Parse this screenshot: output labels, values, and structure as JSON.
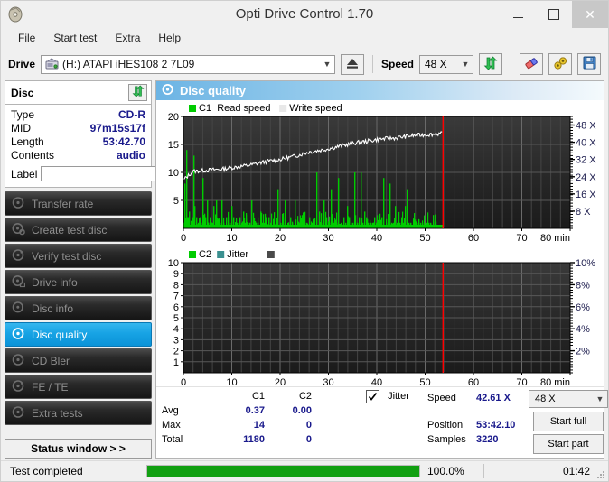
{
  "window": {
    "title": "Opti Drive Control 1.70",
    "icon": "disc-icon",
    "minimize": "–",
    "maximize": "□",
    "close": "×"
  },
  "menu": {
    "items": [
      {
        "label": "File"
      },
      {
        "label": "Start test"
      },
      {
        "label": "Extra"
      },
      {
        "label": "Help"
      }
    ]
  },
  "toolbar": {
    "drive_label": "Drive",
    "drive_value": "(H:)  ATAPI iHES108  2 7L09",
    "eject_icon": "eject-icon",
    "speed_label": "Speed",
    "speed_value": "48 X",
    "refresh_icon": "refresh-icon",
    "eraser_icon": "eraser-icon",
    "tools_icon": "tools-icon",
    "save_icon": "save-icon"
  },
  "disc": {
    "title": "Disc",
    "refresh_icon": "refresh-icon",
    "rows": [
      {
        "key": "Type",
        "value": "CD-R"
      },
      {
        "key": "MID",
        "value": "97m15s17f"
      },
      {
        "key": "Length",
        "value": "53:42.70"
      },
      {
        "key": "Contents",
        "value": "audio"
      }
    ],
    "label_key": "Label",
    "label_value": "",
    "label_placeholder": "",
    "disc_icon": "cd-disc-icon"
  },
  "nav": {
    "items": [
      {
        "label": "Transfer rate",
        "icon": "disc-gear-icon",
        "active": false
      },
      {
        "label": "Create test disc",
        "icon": "disc-write-icon",
        "active": false
      },
      {
        "label": "Verify test disc",
        "icon": "disc-check-icon",
        "active": false
      },
      {
        "label": "Drive info",
        "icon": "drive-info-icon",
        "active": false
      },
      {
        "label": "Disc info",
        "icon": "disc-info-icon",
        "active": false
      },
      {
        "label": "Disc quality",
        "icon": "disc-quality-icon",
        "active": true
      },
      {
        "label": "CD Bler",
        "icon": "disc-bler-icon",
        "active": false
      },
      {
        "label": "FE / TE",
        "icon": "disc-fete-icon",
        "active": false
      },
      {
        "label": "Extra tests",
        "icon": "disc-extra-icon",
        "active": false
      }
    ],
    "status_window_label": "Status window > >"
  },
  "panel": {
    "title": "Disc quality",
    "icon": "disc-quality-icon"
  },
  "stats": {
    "col_headers": [
      "C1",
      "C2"
    ],
    "row_labels": [
      "Avg",
      "Max",
      "Total"
    ],
    "values": [
      [
        "0.37",
        "0.00"
      ],
      [
        "14",
        "0"
      ],
      [
        "1180",
        "0"
      ]
    ],
    "jitter_label": "Jitter",
    "jitter_checked": true,
    "speed_label": "Speed",
    "speed_value": "42.61 X",
    "position_label": "Position",
    "position_value": "53:42.10",
    "samples_label": "Samples",
    "samples_value": "3220",
    "speed_select": "48 X",
    "start_full_label": "Start full",
    "start_part_label": "Start part"
  },
  "statusbar": {
    "message": "Test completed",
    "progress_percent": 100.0,
    "progress_text": "100.0%",
    "elapsed": "01:42"
  },
  "colors": {
    "c1_green": "#00cc00",
    "read_speed_white": "#ffffff",
    "marker_red": "#ff0000",
    "accent_blue": "#1a1a8c",
    "panel_blue": "#6cb4e4",
    "progress_green": "#12a012",
    "plot_bg": "#2b2b2b"
  },
  "chart_data": [
    {
      "id": "c1-chart",
      "type": "bar",
      "title": "",
      "legend": [
        {
          "label": "C1",
          "color": "#00cc00",
          "swatch": true
        },
        {
          "label": "Read speed",
          "color": "#ffffff",
          "swatch": false
        },
        {
          "label": "Write speed",
          "color": "#e8e8e8",
          "swatch": true
        }
      ],
      "legend_position": "top-left",
      "grid": true,
      "xlabel": "min",
      "xlim": [
        0,
        80
      ],
      "xticks": [
        0,
        10,
        20,
        30,
        40,
        50,
        60,
        70,
        80
      ],
      "xticklabels": [
        "0",
        "10",
        "20",
        "30",
        "40",
        "50",
        "60",
        "70",
        "80 min"
      ],
      "ylabel": "C1",
      "ylim": [
        0,
        20
      ],
      "yticks": [
        5,
        10,
        15,
        20
      ],
      "yticklabels": [
        "5",
        "10",
        "15",
        "20"
      ],
      "y2label": "Speed",
      "y2lim": [
        0,
        52
      ],
      "y2ticks": [
        8,
        16,
        24,
        32,
        40,
        48
      ],
      "y2ticklabels": [
        "8 X",
        "16 X",
        "24 X",
        "32 X",
        "40 X",
        "48 X"
      ],
      "marker_x": 53.7,
      "marker_color": "#ff0000",
      "data_end_x": 53.7,
      "series": [
        {
          "name": "C1",
          "type": "bar",
          "color": "#00cc00",
          "x": [
            0.2,
            0.5,
            0.8,
            1.0,
            1.2,
            1.5,
            1.8,
            2.0,
            2.3,
            2.6,
            2.9,
            3.1,
            3.3,
            3.6,
            3.9,
            4.2,
            4.5,
            4.8,
            5.1,
            5.4,
            5.7,
            6.0,
            6.2,
            6.5,
            6.8,
            7.1,
            7.5,
            7.9,
            8.3,
            8.7,
            9.1,
            9.5,
            9.9,
            10.3,
            10.7,
            11.1,
            11.5,
            11.9,
            12.3,
            12.8,
            13.2,
            13.6,
            14.0,
            14.5,
            14.9,
            15.3,
            15.8,
            16.2,
            16.7,
            17.1,
            17.6,
            18.0,
            18.5,
            19.0,
            19.5,
            20.0,
            20.5,
            21.0,
            21.5,
            22.0,
            22.5,
            23.0,
            23.5,
            24.0,
            24.5,
            25.0,
            25.5,
            26.0,
            26.5,
            27.0,
            27.5,
            28.0,
            28.5,
            29.0,
            29.5,
            30.0,
            30.5,
            31.0,
            31.5,
            32.0,
            32.5,
            33.0,
            33.4,
            33.8,
            34.2,
            34.6,
            35.0,
            35.4,
            35.8,
            36.2,
            36.6,
            37.0,
            37.4,
            37.8,
            38.2,
            38.6,
            39.0,
            39.4,
            39.8,
            40.2,
            40.6,
            41.0,
            41.4,
            41.8,
            42.2,
            42.6,
            43.0,
            43.4,
            43.8,
            44.2,
            44.6,
            45.0,
            45.4,
            45.8,
            46.2,
            46.6,
            47.0,
            47.4,
            47.8,
            48.2,
            48.6,
            49.0,
            49.4,
            49.8,
            50.2,
            50.6,
            51.0,
            51.4,
            51.8,
            52.2,
            52.6,
            53.0,
            53.4
          ],
          "values": [
            8,
            14,
            2,
            1,
            3,
            1,
            2,
            13,
            4,
            2,
            1,
            1,
            2,
            1,
            9,
            1,
            2,
            5,
            1,
            2,
            1,
            1,
            4,
            1,
            5,
            1,
            1,
            5,
            1,
            2,
            1,
            1,
            4,
            2,
            1,
            1,
            2,
            1,
            3,
            1,
            1,
            1,
            5,
            1,
            1,
            1,
            3,
            1,
            1,
            2,
            2,
            1,
            1,
            1,
            7,
            1,
            1,
            5,
            1,
            2,
            1,
            5,
            1,
            1,
            2,
            1,
            1,
            2,
            1,
            1,
            10,
            3,
            1,
            5,
            2,
            1,
            7,
            1,
            1,
            9,
            1,
            2,
            1,
            4,
            2,
            1,
            1,
            10,
            1,
            2,
            10,
            1,
            3,
            2,
            1,
            1,
            1,
            2,
            1,
            1,
            1,
            2,
            9,
            1,
            2,
            8,
            1,
            1,
            4,
            1,
            1,
            2,
            1,
            4,
            7,
            1,
            1,
            1,
            1,
            1,
            1,
            1,
            1,
            1,
            1,
            1,
            1
          ]
        },
        {
          "name": "Read speed",
          "type": "line",
          "color": "#ffffff",
          "axis": "y2",
          "x": [
            0,
            2,
            5,
            8,
            11,
            14,
            17,
            20,
            23,
            26,
            29,
            32,
            35,
            38,
            41,
            44,
            47,
            50,
            53.5
          ],
          "values": [
            22.5,
            26.5,
            27.0,
            27.5,
            28.5,
            29.5,
            31.0,
            32.0,
            33.5,
            35.5,
            36.5,
            38.0,
            39.5,
            40.5,
            41.5,
            42.0,
            43.0,
            43.5,
            44.0
          ]
        }
      ]
    },
    {
      "id": "c2-jitter-chart",
      "type": "line",
      "title": "",
      "legend": [
        {
          "label": "C2",
          "color": "#00cc00",
          "swatch": true
        },
        {
          "label": "Jitter",
          "color": "#3a8f8f",
          "swatch": true
        },
        {
          "label": "",
          "color": "#4a4a4a",
          "swatch": true
        }
      ],
      "legend_position": "top-left",
      "grid": true,
      "xlabel": "min",
      "xlim": [
        0,
        80
      ],
      "xticks": [
        0,
        10,
        20,
        30,
        40,
        50,
        60,
        70,
        80
      ],
      "xticklabels": [
        "0",
        "10",
        "20",
        "30",
        "40",
        "50",
        "60",
        "70",
        "80 min"
      ],
      "ylabel": "C2",
      "ylim": [
        0,
        10
      ],
      "yticks": [
        1,
        2,
        3,
        4,
        5,
        6,
        7,
        8,
        9,
        10
      ],
      "yticklabels": [
        "1",
        "2",
        "3",
        "4",
        "5",
        "6",
        "7",
        "8",
        "9",
        "10"
      ],
      "y2label": "Jitter",
      "y2lim": [
        0,
        10
      ],
      "y2ticks": [
        2,
        4,
        6,
        8,
        10
      ],
      "y2ticklabels": [
        "2%",
        "4%",
        "6%",
        "8%",
        "10%"
      ],
      "marker_x": 53.7,
      "marker_color": "#ff0000",
      "series": [
        {
          "name": "C2",
          "type": "bar",
          "color": "#00cc00",
          "x": [],
          "values": []
        },
        {
          "name": "Jitter",
          "type": "line",
          "color": "#3a8f8f",
          "x": [],
          "values": []
        }
      ]
    }
  ]
}
